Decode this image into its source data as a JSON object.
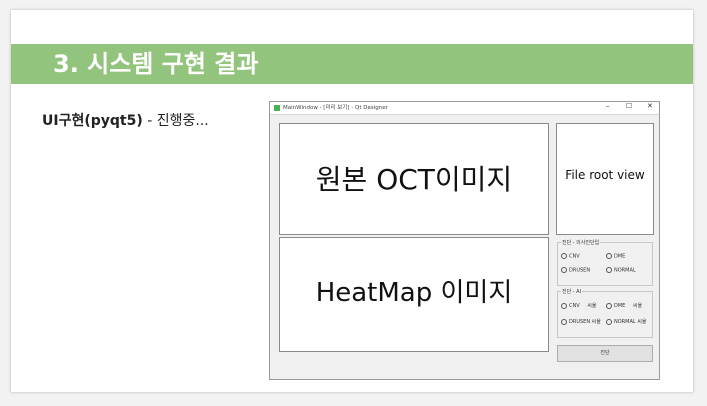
{
  "slide": {
    "title": "3. 시스템 구현 결과",
    "bullet": {
      "bold": "UI구현(pyqt5)",
      "rest": " - 진행중..."
    }
  },
  "qt_window": {
    "title": "MainWindow - [미리 보기] - Qt Designer",
    "controls": {
      "minimize": "–",
      "maximize": "☐",
      "close": "✕"
    },
    "original_panel": "원본 OCT이미지",
    "heatmap_panel": "HeatMap 이미지",
    "file_panel": "File root view",
    "group1": {
      "title": "진단 - 의사진단입",
      "options": [
        "CNV",
        "DME",
        "DRUSEN",
        "NORMAL"
      ]
    },
    "group2": {
      "title": "진단 - AI",
      "options": [
        "CNV",
        "DME",
        "DRUSEN",
        "NORMAL"
      ],
      "suffix": "씨율"
    },
    "diagnose_button": "진단"
  }
}
